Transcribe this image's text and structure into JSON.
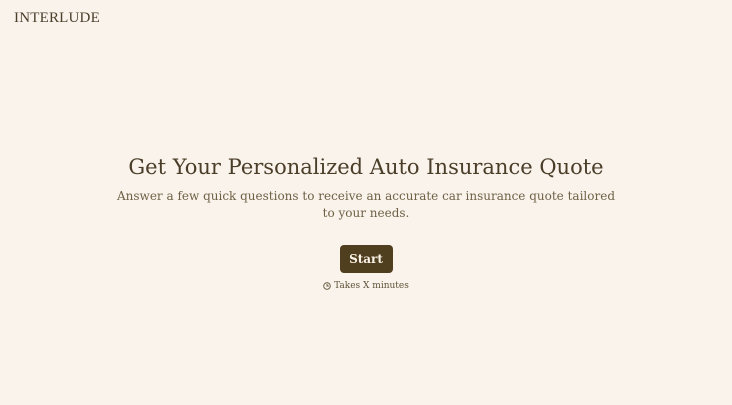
{
  "header": {
    "logo_text": "INTERLUDE"
  },
  "hero": {
    "title": "Get Your Personalized Auto Insurance Quote",
    "subtitle": "Answer a few quick questions to receive an accurate car insurance quote tailored to your needs.",
    "start_label": "Start",
    "duration_text": "Takes X minutes",
    "duration_icon": "clock-icon"
  },
  "colors": {
    "background": "#faf3eb",
    "text": "#4a3e29",
    "button_bg": "#4f3f1f",
    "button_text": "#fbf3e6"
  }
}
